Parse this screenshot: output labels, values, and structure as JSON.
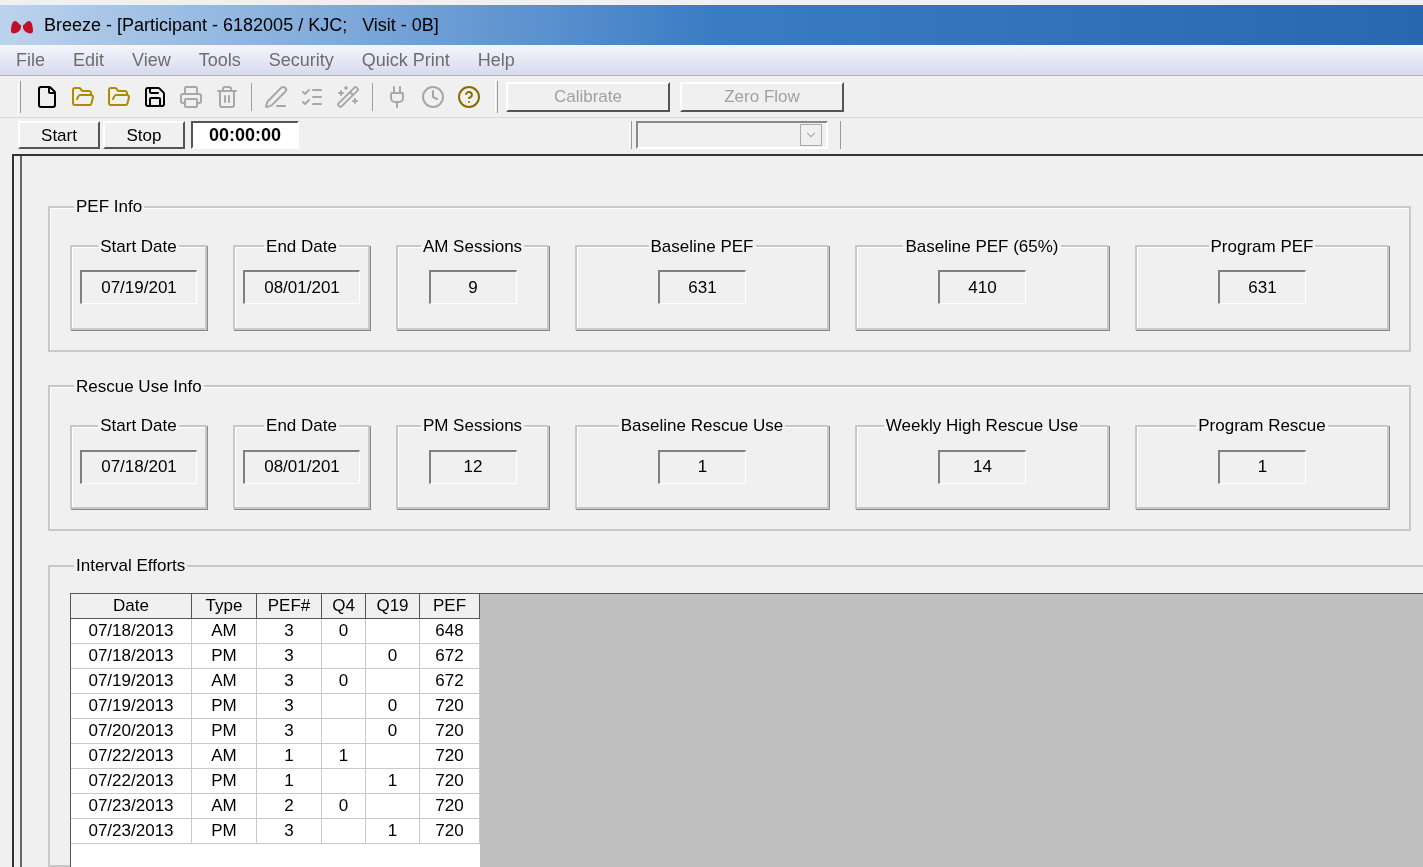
{
  "window": {
    "title": "Breeze - [Participant - 6182005 / KJC;   Visit - 0B]"
  },
  "menu": [
    "File",
    "Edit",
    "View",
    "Tools",
    "Security",
    "Quick Print",
    "Help"
  ],
  "toolbar": {
    "icons": [
      {
        "kind": "new",
        "disabled": false
      },
      {
        "kind": "open",
        "disabled": false
      },
      {
        "kind": "open",
        "disabled": false
      },
      {
        "kind": "save",
        "disabled": false
      },
      {
        "kind": "print",
        "disabled": true
      },
      {
        "kind": "delete",
        "disabled": true
      },
      {
        "kind": "sep"
      },
      {
        "kind": "pen",
        "disabled": true
      },
      {
        "kind": "list",
        "disabled": true
      },
      {
        "kind": "wand",
        "disabled": true
      },
      {
        "kind": "sep"
      },
      {
        "kind": "device",
        "disabled": true
      },
      {
        "kind": "clock",
        "disabled": true
      },
      {
        "kind": "help",
        "disabled": false
      }
    ],
    "buttons": [
      {
        "label": "Calibrate",
        "disabled": true
      },
      {
        "label": "Zero Flow",
        "disabled": true
      }
    ]
  },
  "timer_bar": {
    "buttons": [
      "Start",
      "Stop"
    ],
    "time": "00:00:00",
    "combo": {
      "disabled": true
    }
  },
  "groups": [
    {
      "title": "PEF Info",
      "fields": [
        {
          "label": "Start Date",
          "value": "07/19/201"
        },
        {
          "label": "End Date",
          "value": "08/01/201"
        },
        {
          "label": "AM Sessions",
          "value": "9"
        },
        {
          "label": "Baseline PEF",
          "value": "631"
        },
        {
          "label": "Baseline PEF (65%)",
          "value": "410"
        },
        {
          "label": "Program PEF",
          "value": "631"
        }
      ]
    },
    {
      "title": "Rescue Use Info",
      "fields": [
        {
          "label": "Start Date",
          "value": "07/18/201"
        },
        {
          "label": "End Date",
          "value": "08/01/201"
        },
        {
          "label": "PM Sessions",
          "value": "12"
        },
        {
          "label": "Baseline Rescue Use",
          "value": "1"
        },
        {
          "label": "Weekly High Rescue Use",
          "value": "14"
        },
        {
          "label": "Program Rescue",
          "value": "1"
        }
      ]
    }
  ],
  "interval_efforts": {
    "title": "Interval Efforts",
    "columns": [
      "Date",
      "Type",
      "PEF#",
      "Q4",
      "Q19",
      "PEF"
    ],
    "rows": [
      [
        "07/18/2013",
        "AM",
        "3",
        "0",
        "",
        "648"
      ],
      [
        "07/18/2013",
        "PM",
        "3",
        "",
        "0",
        "672"
      ],
      [
        "07/19/2013",
        "AM",
        "3",
        "0",
        "",
        "672"
      ],
      [
        "07/19/2013",
        "PM",
        "3",
        "",
        "0",
        "720"
      ],
      [
        "07/20/2013",
        "PM",
        "3",
        "",
        "0",
        "720"
      ],
      [
        "07/22/2013",
        "AM",
        "1",
        "1",
        "",
        "720"
      ],
      [
        "07/22/2013",
        "PM",
        "1",
        "",
        "1",
        "720"
      ],
      [
        "07/23/2013",
        "AM",
        "2",
        "0",
        "",
        "720"
      ],
      [
        "07/23/2013",
        "PM",
        "3",
        "",
        "1",
        "720"
      ]
    ]
  }
}
